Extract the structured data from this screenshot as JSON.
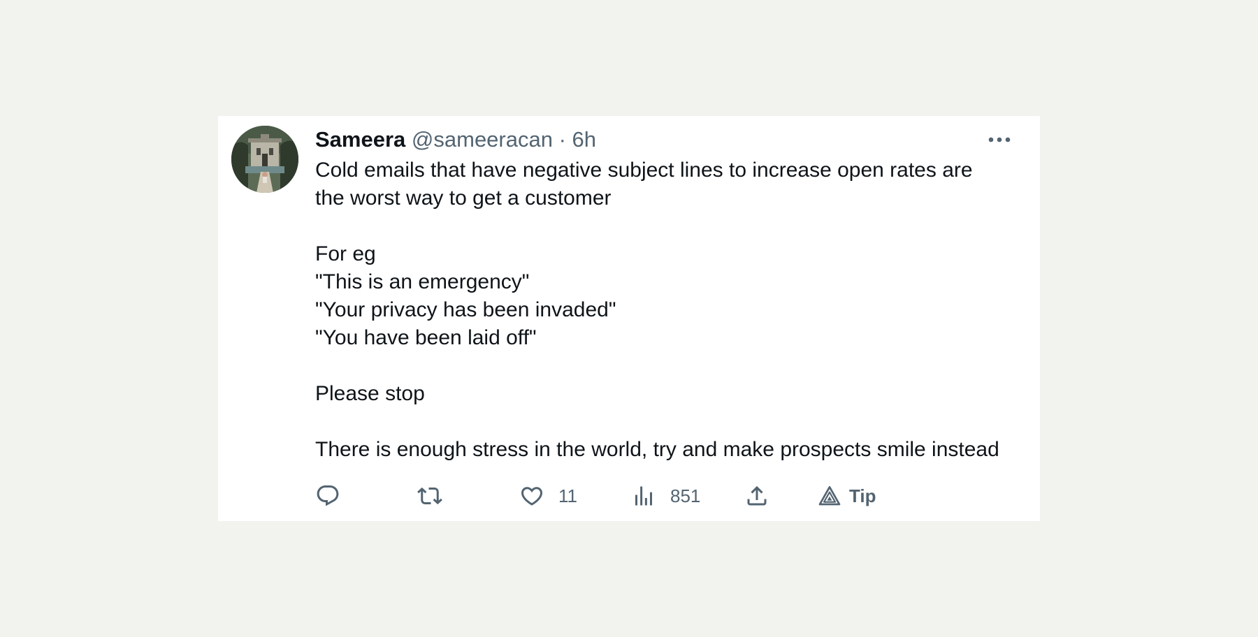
{
  "tweet": {
    "author_name": "Sameera",
    "author_handle": "@sameeracan",
    "separator": "·",
    "time": "6h",
    "text_lines": [
      "Cold emails that have negative subject lines to increase open rates are",
      "the worst way to get a customer",
      "For eg",
      "\"This is an emergency\"",
      "\"Your privacy has been invaded\"",
      "\"You have been laid off\"",
      "Please stop",
      "There is enough stress in the world, try and make prospects smile instead"
    ]
  },
  "actions": {
    "reply_icon": "reply-icon",
    "retweet_icon": "retweet-icon",
    "like_icon": "heart-icon",
    "like_count": "11",
    "views_icon": "bar-chart-icon",
    "views_count": "851",
    "share_icon": "share-icon",
    "tip_icon": "tip-icon",
    "tip_label": "Tip"
  },
  "colors": {
    "page_background": "#f2f2ee",
    "card_background": "#ffffff",
    "primary_text": "#0f1419",
    "secondary_text": "#536471"
  }
}
